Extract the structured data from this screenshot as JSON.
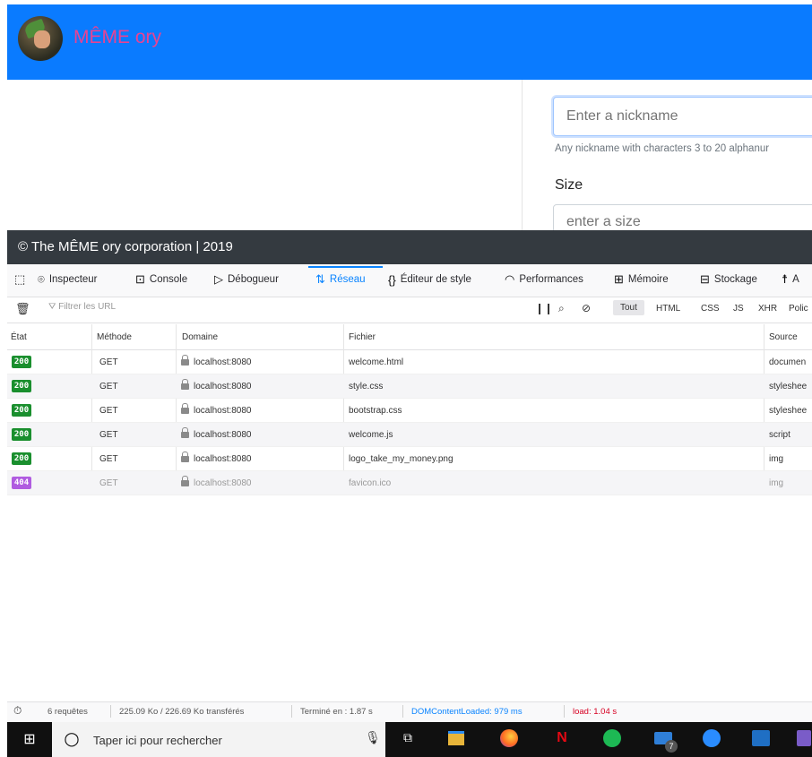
{
  "site": {
    "brand": "MÊME ory",
    "nickname_placeholder": "Enter a nickname",
    "nickname_help": "Any nickname with characters 3 to 20 alphanur",
    "size_label": "Size",
    "size_placeholder": "enter a size",
    "footer": "© The MÊME ory corporation | 2019"
  },
  "devtools": {
    "tabs": [
      "Inspecteur",
      "Console",
      "Débogueur",
      "Réseau",
      "Éditeur de style",
      "Performances",
      "Mémoire",
      "Stockage",
      "A"
    ],
    "active_tab": "Réseau",
    "filter_placeholder": "Filtrer les URL",
    "type_filters": [
      "Tout",
      "HTML",
      "CSS",
      "JS",
      "XHR",
      "Polic"
    ],
    "columns": [
      "État",
      "Méthode",
      "Domaine",
      "Fichier",
      "Source"
    ],
    "requests": [
      {
        "status": "200",
        "method": "GET",
        "domain": "localhost:8080",
        "file": "welcome.html",
        "source": "documen"
      },
      {
        "status": "200",
        "method": "GET",
        "domain": "localhost:8080",
        "file": "style.css",
        "source": "styleshee"
      },
      {
        "status": "200",
        "method": "GET",
        "domain": "localhost:8080",
        "file": "bootstrap.css",
        "source": "styleshee"
      },
      {
        "status": "200",
        "method": "GET",
        "domain": "localhost:8080",
        "file": "welcome.js",
        "source": "script"
      },
      {
        "status": "200",
        "method": "GET",
        "domain": "localhost:8080",
        "file": "logo_take_my_money.png",
        "source": "img"
      },
      {
        "status": "404",
        "method": "GET",
        "domain": "localhost:8080",
        "file": "favicon.ico",
        "source": "img"
      }
    ],
    "status_bar": {
      "requests": "6 requêtes",
      "transferred": "225.09 Ko / 226.69 Ko transférés",
      "finished": "Terminé en : 1.87 s",
      "dom_loaded": "DOMContentLoaded: 979 ms",
      "load": "load: 1.04 s"
    }
  },
  "taskbar": {
    "search_placeholder": "Taper ici pour rechercher",
    "mail_badge": "7"
  },
  "colors": {
    "header_blue": "#0a7bff",
    "brand_pink": "#e84393",
    "status_ok": "#1a8f2e",
    "status_404": "#b05ce0",
    "devtools_accent": "#0a84ff"
  }
}
